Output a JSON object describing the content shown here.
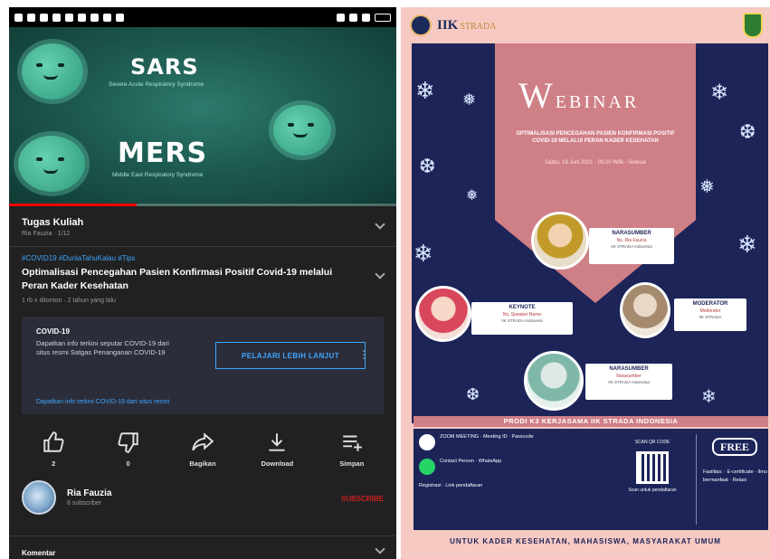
{
  "statusbar": {
    "time": "",
    "battery": ""
  },
  "video": {
    "title_sars": "SARS",
    "sub_sars": "Severe Acute Respiratory Syndrome",
    "title_mers": "MERS",
    "sub_mers": "Middle East Respiratory Syndrome",
    "progress_fraction": 0.33
  },
  "playlist": {
    "title": "Tugas Kuliah",
    "meta": "Ria Fauzia · 1/12"
  },
  "videoinfo": {
    "hashtags": "#COVID19 #DuniaTahuKalau #Tips",
    "title": "Optimalisasi Pencegahan Pasien Konfirmasi Positif Covid-19 melalui Peran Kader Kesehatan",
    "meta": "1 rb x ditonton · 2 tahun yang lalu"
  },
  "covid": {
    "heading": "COVID-19",
    "text": "Dapatkan info terkini seputar COVID-19 dari situs resmi Satgas Penanganan COVID-19",
    "button": "PELAJARI LEBIH LANJUT",
    "footer": "Dapatkan info terkini COVID-19 dari situs resmi"
  },
  "actions": [
    {
      "label": "2"
    },
    {
      "label": "0"
    },
    {
      "label": "Bagikan"
    },
    {
      "label": "Download"
    },
    {
      "label": "Simpan"
    }
  ],
  "channel": {
    "name": "Ria Fauzia",
    "subs": "8 subscriber",
    "subscribe": "SUBSCRIBE"
  },
  "comments": {
    "label": "Komentar"
  },
  "poster": {
    "logo": "IIK",
    "logo_sub": "STRADA",
    "webinar_big": "W",
    "webinar_rest": "EBINAR",
    "theme": "OPTIMALISASI PENCEGAHAN PASIEN KONFIRMASI POSITIF COVID-19 MELALUI PERAN KADER KESEHATAN",
    "date": "Sabtu, 19 Juni 2021 · 09.00 WIB - Selesai",
    "speaker_main_role": "NARASUMBER",
    "speaker_main_name": "Ns. Ria Fauzia",
    "speaker_main_inst": "IIK STRADA Indonesia",
    "speaker_l_role": "KEYNOTE",
    "speaker_l_name": "Ns. Speaker Name",
    "speaker_l_inst": "IIK STRADA Indonesia",
    "speaker_r_role": "MODERATOR",
    "speaker_r_name": "Moderator",
    "speaker_r_inst": "IIK STRADA",
    "speaker_b_role": "NARASUMBER",
    "speaker_b_name": "Narasumber",
    "speaker_b_inst": "IIK STRADA Indonesia",
    "strip": "PRODI K3 KERJASAMA IIK STRADA INDONESIA",
    "info_zoom": "ZOOM MEETING · Meeting ID · Passcode",
    "info_wa": "Contact Person · WhatsApp",
    "info_reg": "Registrasi · Link pendaftaran",
    "scan": "SCAN QR CODE",
    "scan_note": "Scan untuk pendaftaran",
    "free": "FREE",
    "benefits": "Fasilitas: · E-certificate · Ilmu bermanfaat · Relasi",
    "footer": "UNTUK KADER KESEHATAN, MAHASISWA, MASYARAKAT UMUM"
  }
}
